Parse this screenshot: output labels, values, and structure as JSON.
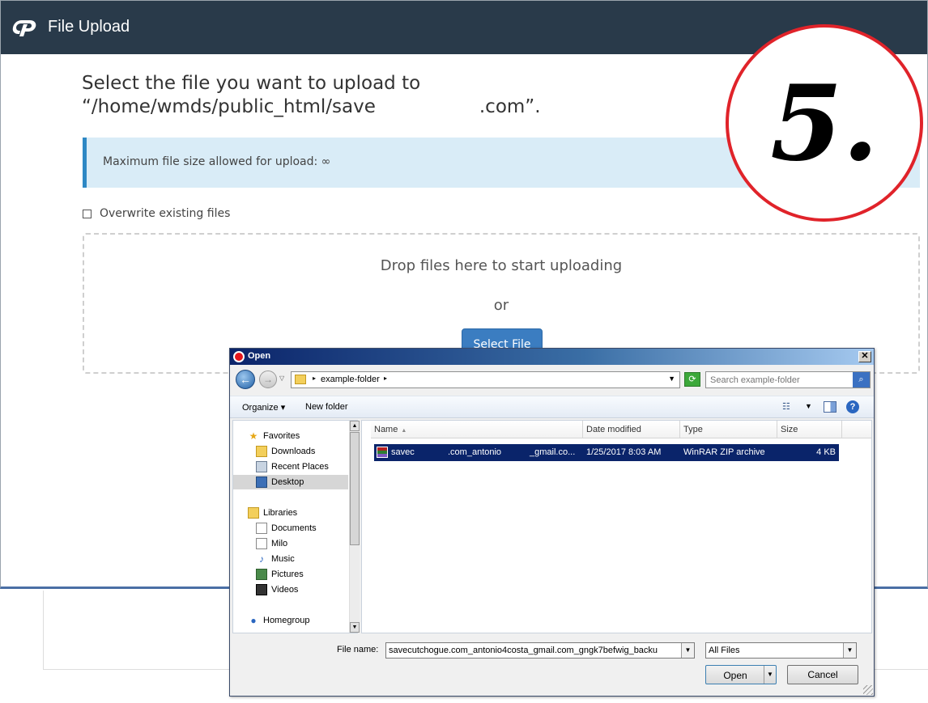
{
  "app": {
    "title": "File Upload",
    "logo": "cpanel-logo"
  },
  "main": {
    "headline_line1": "Select the file you want to upload to",
    "headline_path": "“/home/wmds/public_html/save",
    "headline_suffix": ".com”.",
    "max_size_label": "Maximum file size allowed for upload: ∞",
    "overwrite_label": "Overwrite existing files",
    "drop_text": "Drop files here to start uploading",
    "or_text": "or",
    "select_file_label": "Select File"
  },
  "annotation": {
    "step": "5."
  },
  "dialog": {
    "title": "Open",
    "close_glyph": "✕",
    "address": {
      "folder": "example-folder",
      "search_placeholder": "Search example-folder"
    },
    "toolbar": {
      "organize": "Organize",
      "new_folder": "New folder",
      "views_glyph": "☷",
      "help_glyph": "?"
    },
    "nav": {
      "favorites": "Favorites",
      "downloads": "Downloads",
      "recent_places": "Recent Places",
      "desktop": "Desktop",
      "libraries": "Libraries",
      "documents": "Documents",
      "milo": "Milo",
      "music": "Music",
      "pictures": "Pictures",
      "videos": "Videos",
      "homegroup": "Homegroup"
    },
    "columns": {
      "name": "Name",
      "date_modified": "Date modified",
      "type": "Type",
      "size": "Size"
    },
    "file": {
      "name_part1": "savec",
      "name_part2": ".com_antonio",
      "name_part3": "_gmail.co...",
      "date": "1/25/2017 8:03 AM",
      "type": "WinRAR ZIP archive",
      "size": "4 KB"
    },
    "bottom": {
      "file_name_label": "File name:",
      "file_name_value": "savecutchogue.com_antonio4costa_gmail.com_gngk7befwig_backu",
      "filter": "All Files",
      "open_label": "Open",
      "cancel_label": "Cancel"
    }
  },
  "colors": {
    "header_bg": "#293a4a",
    "alert_bg": "#d9ecf7",
    "alert_border": "#2e88c4",
    "button_blue": "#3b7dc1",
    "circle_red": "#e0232a",
    "selection": "#0a246a"
  }
}
